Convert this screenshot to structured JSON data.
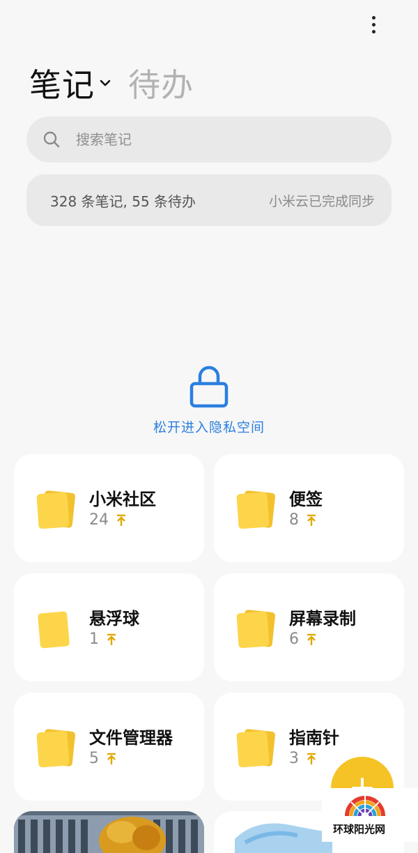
{
  "header": {
    "more_icon": "more-vertical-icon"
  },
  "tabs": {
    "notes_label": "笔记",
    "todo_label": "待办"
  },
  "search": {
    "placeholder": "搜索笔记",
    "value": ""
  },
  "stats": {
    "count_text": "328 条笔记, 55 条待办",
    "sync_text": "小米云已完成同步"
  },
  "privacy": {
    "hint": "松开进入隐私空间",
    "icon": "lock-icon"
  },
  "folders": [
    {
      "name": "小米社区",
      "count": "24",
      "pinned": true,
      "icon": "folder-stack-icon"
    },
    {
      "name": "便签",
      "count": "8",
      "pinned": true,
      "icon": "folder-stack-icon"
    },
    {
      "name": "悬浮球",
      "count": "1",
      "pinned": true,
      "icon": "folder-single-icon"
    },
    {
      "name": "屏幕录制",
      "count": "6",
      "pinned": true,
      "icon": "folder-stack-icon"
    },
    {
      "name": "文件管理器",
      "count": "5",
      "pinned": true,
      "icon": "folder-stack-icon"
    },
    {
      "name": "指南针",
      "count": "3",
      "pinned": true,
      "icon": "folder-stack-icon"
    }
  ],
  "fab": {
    "icon": "plus-icon"
  },
  "watermark": {
    "text": "环球阳光网"
  },
  "colors": {
    "accent": "#f5c325",
    "folder": "#fdd33c",
    "privacy_blue": "#2a7fe0",
    "background": "#f7f7f7"
  }
}
